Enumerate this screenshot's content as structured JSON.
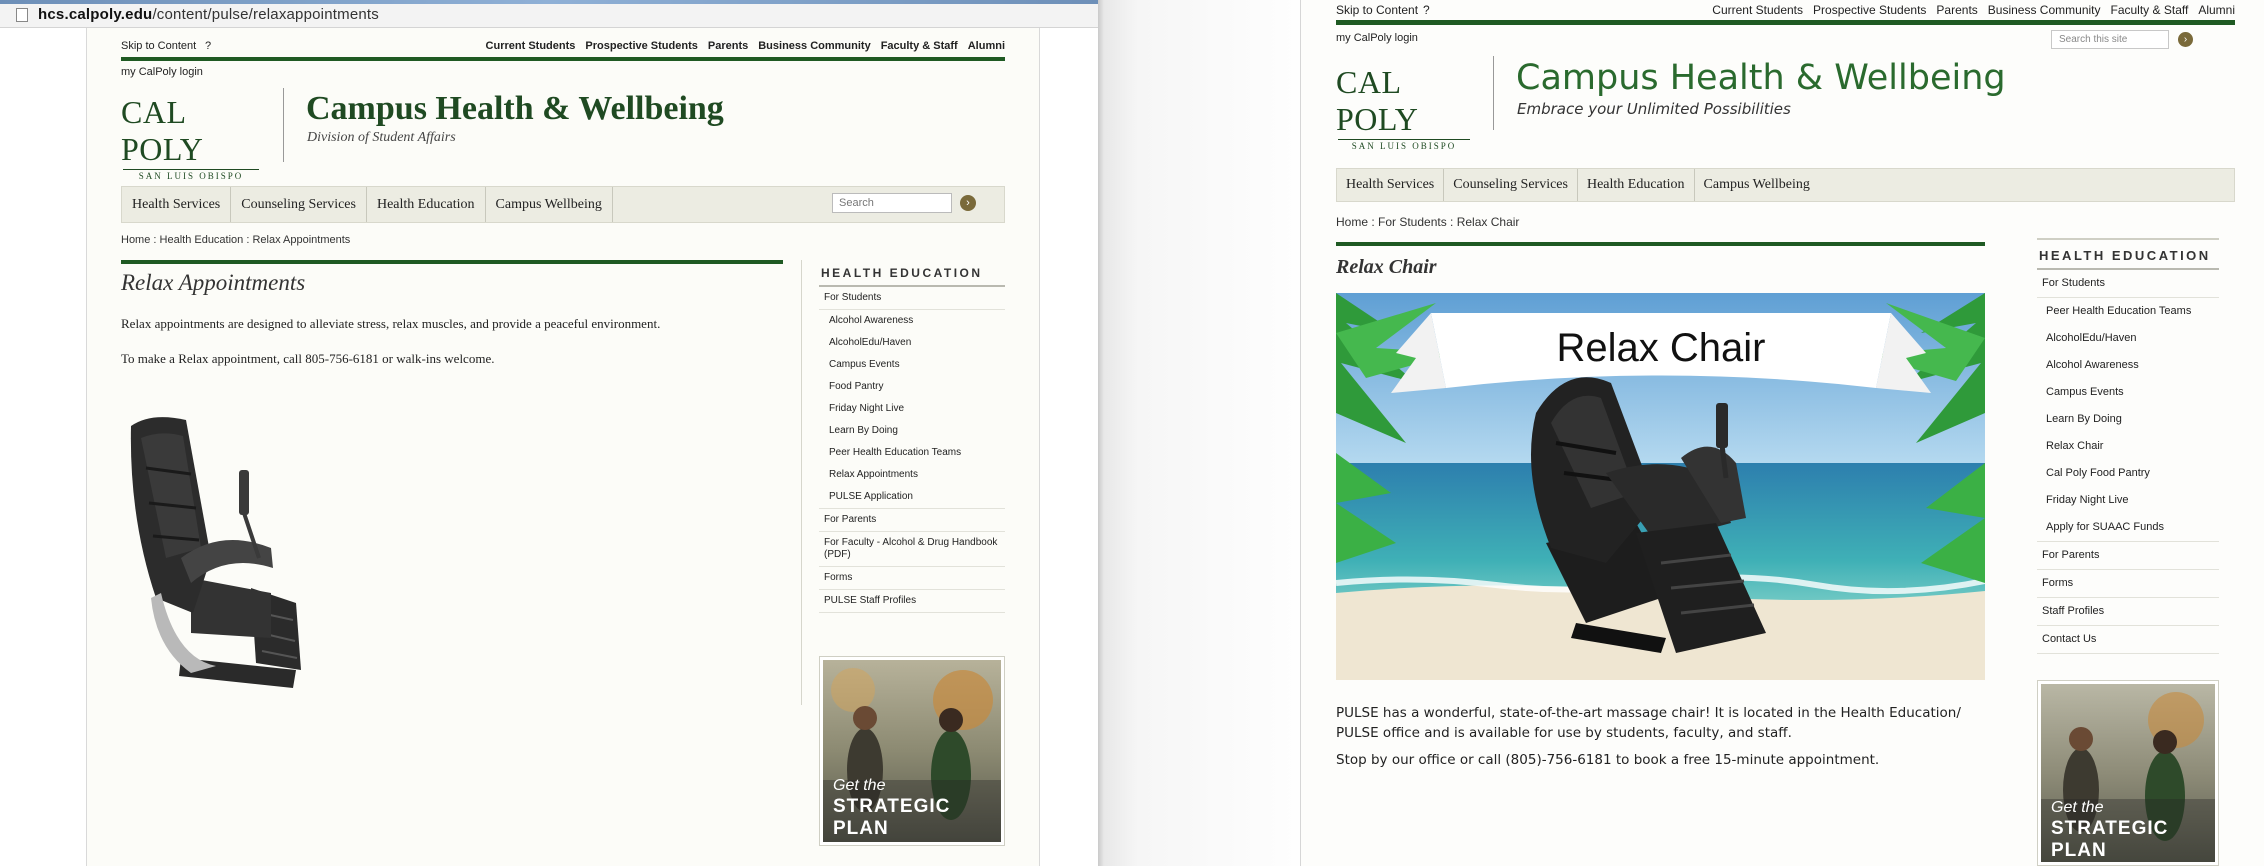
{
  "left_window": {
    "url": {
      "domain": "hcs.calpoly.edu",
      "path": "/content/pulse/relaxappointments"
    },
    "header": {
      "skip_to_content": "Skip to Content",
      "help": "?",
      "audience_links": [
        "Current Students",
        "Prospective Students",
        "Parents",
        "Business Community",
        "Faculty & Staff",
        "Alumni"
      ],
      "login": "my CalPoly login",
      "logo_main": "CAL POLY",
      "logo_sub": "SAN LUIS OBISPO",
      "site_title": "Campus Health & Wellbeing",
      "site_subtitle": "Division of Student Affairs"
    },
    "nav": {
      "items": [
        "Health Services",
        "Counseling Services",
        "Health Education",
        "Campus Wellbeing"
      ],
      "search_placeholder": "Search",
      "search_button": "›"
    },
    "breadcrumb": "Home : Health Education : Relax Appointments",
    "content": {
      "heading": "Relax Appointments",
      "paragraph_1": "Relax appointments are designed to alleviate stress, relax muscles, and provide a peaceful environment.",
      "paragraph_2": "To make a Relax appointment, call 805-756-6181 or walk-ins welcome."
    },
    "sidebar": {
      "heading": "HEALTH EDUCATION",
      "items": [
        {
          "label": "For Students",
          "sub": false
        },
        {
          "label": "Alcohol Awareness",
          "sub": true
        },
        {
          "label": "AlcoholEdu/Haven",
          "sub": true
        },
        {
          "label": "Campus Events",
          "sub": true
        },
        {
          "label": "Food Pantry",
          "sub": true
        },
        {
          "label": "Friday Night Live",
          "sub": true
        },
        {
          "label": "Learn By Doing",
          "sub": true
        },
        {
          "label": "Peer Health Education Teams",
          "sub": true
        },
        {
          "label": "Relax Appointments",
          "sub": true
        },
        {
          "label": "PULSE Application",
          "sub": true
        },
        {
          "label": "For Parents",
          "sub": false
        },
        {
          "label": "For Faculty - Alcohol & Drug Handbook (PDF)",
          "sub": false
        },
        {
          "label": "Forms",
          "sub": false
        },
        {
          "label": "PULSE Staff Profiles",
          "sub": false
        }
      ]
    },
    "banner": {
      "line_1": "Get the",
      "line_2": "STRATEGIC",
      "line_3": "PLAN"
    }
  },
  "right_window": {
    "header": {
      "skip_to_content": "Skip to Content",
      "help": "?",
      "audience_links": [
        "Current Students",
        "Prospective Students",
        "Parents",
        "Business Community",
        "Faculty & Staff",
        "Alumni"
      ],
      "login": "my CalPoly login",
      "search_placeholder": "Search this site",
      "search_button": "›",
      "logo_main": "CAL POLY",
      "logo_sub": "SAN LUIS OBISPO",
      "site_title": "Campus Health & Wellbeing",
      "site_subtitle": "Embrace your Unlimited Possibilities"
    },
    "nav": {
      "items": [
        "Health Services",
        "Counseling Services",
        "Health Education",
        "Campus Wellbeing"
      ]
    },
    "breadcrumb": "Home : For Students : Relax Chair",
    "content": {
      "heading": "Relax Chair",
      "hero_text": "Relax Chair",
      "paragraph_1": "PULSE has a wonderful, state-of-the-art massage chair! It is located in the Health Education/ PULSE office and is available for use by students, faculty, and staff.",
      "paragraph_2": "Stop by our office or call (805)-756-6181 to book a free 15-minute appointment."
    },
    "sidebar": {
      "heading": "HEALTH EDUCATION",
      "items": [
        {
          "label": "For Students",
          "sub": false
        },
        {
          "label": "Peer Health Education Teams",
          "sub": true
        },
        {
          "label": "AlcoholEdu/Haven",
          "sub": true
        },
        {
          "label": "Alcohol Awareness",
          "sub": true
        },
        {
          "label": "Campus Events",
          "sub": true
        },
        {
          "label": "Learn By Doing",
          "sub": true
        },
        {
          "label": "Relax Chair",
          "sub": true
        },
        {
          "label": "Cal Poly Food Pantry",
          "sub": true
        },
        {
          "label": "Friday Night Live",
          "sub": true
        },
        {
          "label": "Apply for SUAAC Funds",
          "sub": true
        },
        {
          "label": "For Parents",
          "sub": false
        },
        {
          "label": "Forms",
          "sub": false
        },
        {
          "label": "Staff Profiles",
          "sub": false
        },
        {
          "label": "Contact Us",
          "sub": false
        }
      ]
    },
    "banner": {
      "line_1": "Get the",
      "line_2": "STRATEGIC",
      "line_3": "PLAN"
    }
  },
  "colors": {
    "brand_green": "#1f5a23",
    "title_green_left": "#1f4a22",
    "title_green_right": "#2a6a2e",
    "nav_bg": "#ecece2",
    "search_button": "#7a6a3a"
  }
}
